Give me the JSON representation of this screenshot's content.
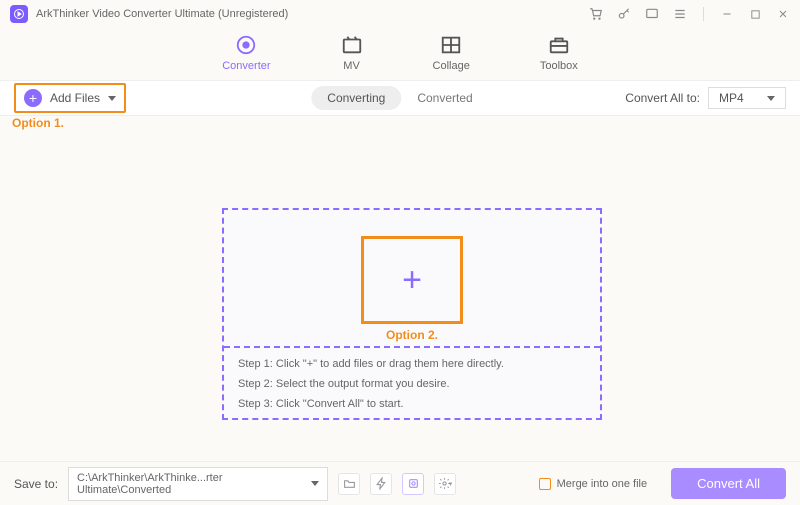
{
  "title": "ArkThinker Video Converter Ultimate (Unregistered)",
  "nav": {
    "converter": "Converter",
    "mv": "MV",
    "collage": "Collage",
    "toolbox": "Toolbox"
  },
  "toolbar": {
    "add_files": "Add Files",
    "option1": "Option 1.",
    "tab_converting": "Converting",
    "tab_converted": "Converted",
    "convert_all_to": "Convert All to:",
    "format": "MP4"
  },
  "dropzone": {
    "option2": "Option 2.",
    "step1": "Step 1: Click \"+\" to add files or drag them here directly.",
    "step2": "Step 2: Select the output format you desire.",
    "step3": "Step 3: Click \"Convert All\" to start."
  },
  "footer": {
    "save_to": "Save to:",
    "path": "C:\\ArkThinker\\ArkThinke...rter Ultimate\\Converted",
    "merge": "Merge into one file",
    "convert_all": "Convert All"
  }
}
